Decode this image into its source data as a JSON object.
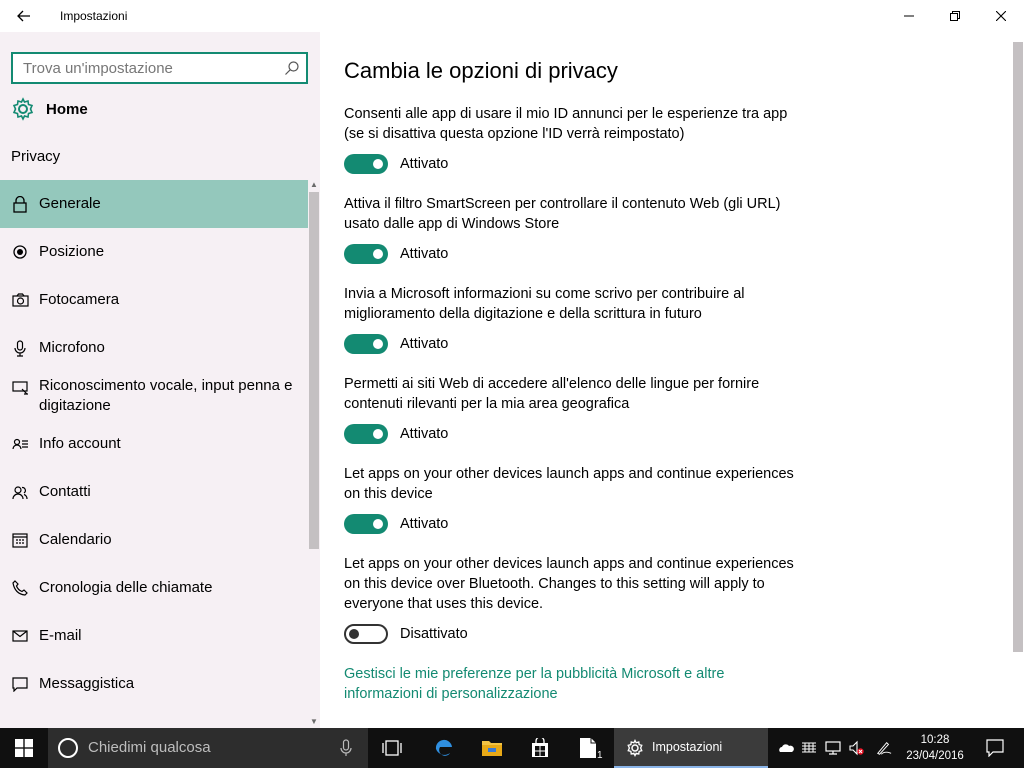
{
  "window": {
    "title": "Impostazioni"
  },
  "sidebar": {
    "search_placeholder": "Trova un'impostazione",
    "home_label": "Home",
    "section_title": "Privacy",
    "items": [
      {
        "label": "Generale",
        "icon": "lock-icon",
        "active": true
      },
      {
        "label": "Posizione",
        "icon": "location-icon"
      },
      {
        "label": "Fotocamera",
        "icon": "camera-icon"
      },
      {
        "label": "Microfono",
        "icon": "microphone-icon"
      },
      {
        "label": "Riconoscimento vocale, input penna e digitazione",
        "icon": "speech-icon"
      },
      {
        "label": "Info account",
        "icon": "account-info-icon"
      },
      {
        "label": "Contatti",
        "icon": "contacts-icon"
      },
      {
        "label": "Calendario",
        "icon": "calendar-icon"
      },
      {
        "label": "Cronologia delle chiamate",
        "icon": "call-history-icon"
      },
      {
        "label": "E-mail",
        "icon": "email-icon"
      },
      {
        "label": "Messaggistica",
        "icon": "messaging-icon"
      }
    ]
  },
  "main": {
    "title": "Cambia le opzioni di privacy",
    "settings": [
      {
        "description": "Consenti alle app di usare il mio ID annunci per le esperienze tra app (se si disattiva questa opzione l'ID verrà reimpostato)",
        "state": "Attivato",
        "on": true
      },
      {
        "description": "Attiva il filtro SmartScreen per controllare il contenuto Web (gli URL) usato dalle app di Windows Store",
        "state": "Attivato",
        "on": true
      },
      {
        "description": "Invia a Microsoft informazioni su come scrivo per contribuire al miglioramento della digitazione e della scrittura in futuro",
        "state": "Attivato",
        "on": true
      },
      {
        "description": "Permetti ai siti Web di accedere all'elenco delle lingue per fornire contenuti rilevanti per la mia area geografica",
        "state": "Attivato",
        "on": true
      },
      {
        "description": "Let apps on your other devices launch apps and continue experiences on this device",
        "state": "Attivato",
        "on": true
      },
      {
        "description": "Let apps on your other devices launch apps and continue experiences on this device over Bluetooth. Changes to this setting will apply to everyone that uses this device.",
        "state": "Disattivato",
        "on": false
      }
    ],
    "link": "Gestisci le mie preferenze per la pubblicità Microsoft e altre informazioni di personalizzazione"
  },
  "taskbar": {
    "search_placeholder": "Chiedimi qualcosa",
    "active_app": "Impostazioni",
    "store_badge": "1",
    "time": "10:28",
    "date": "23/04/2016"
  },
  "colors": {
    "accent": "#138a72",
    "sidebar_bg": "#f6f0f4",
    "active_item_bg": "#94c8bc",
    "taskbar_bg": "#101010"
  }
}
